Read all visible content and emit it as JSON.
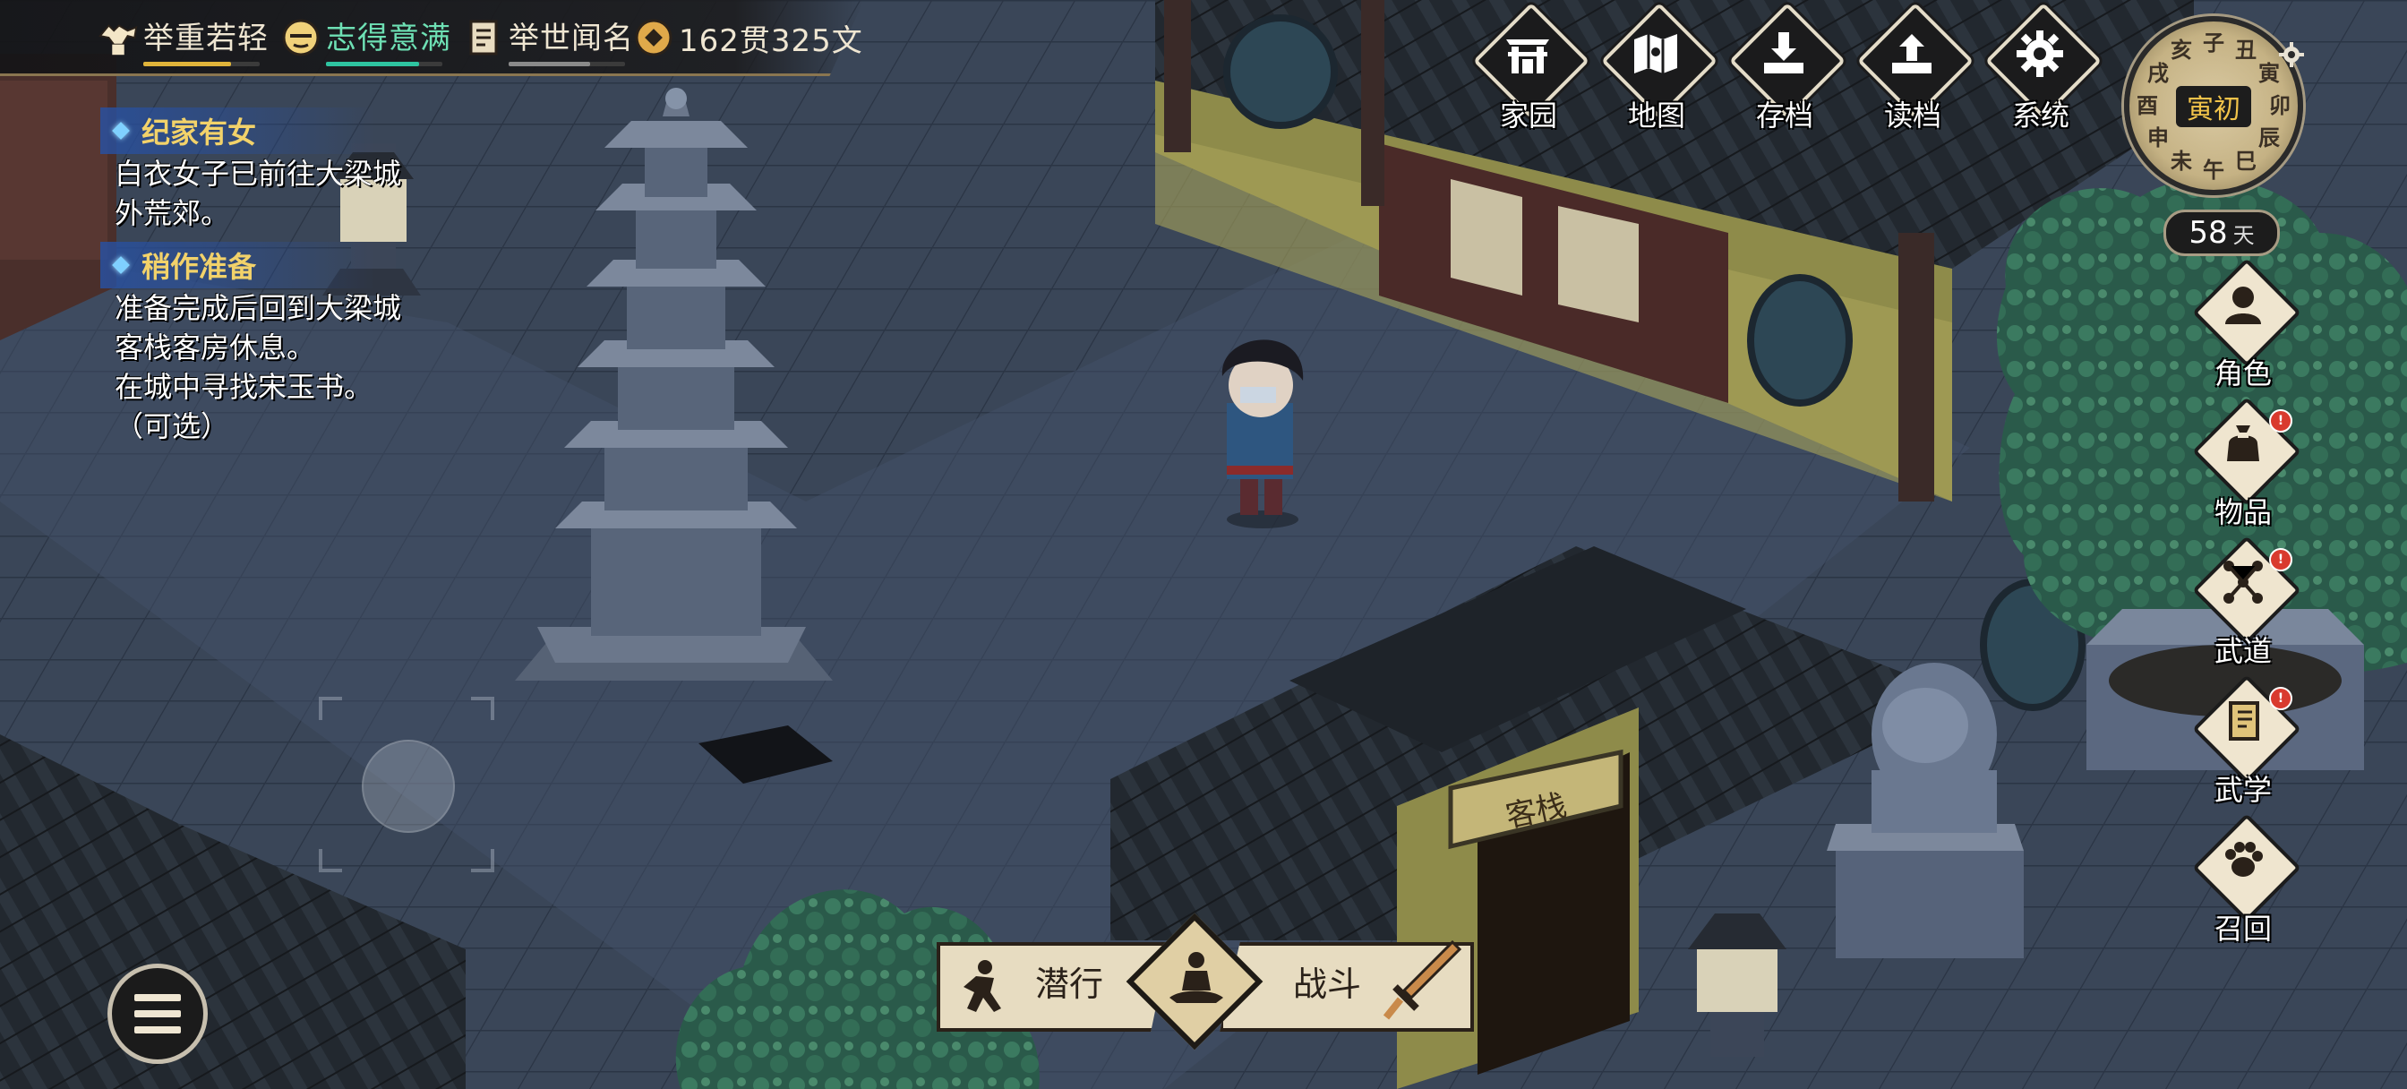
{
  "status_bar": {
    "stats": [
      {
        "icon": "muscle-icon",
        "label": "举重若轻",
        "bar_color": "#e0b43a",
        "fill": 0.75
      },
      {
        "icon": "face-icon",
        "label": "志得意满",
        "bar_color": "#2ec4a0",
        "fill": 0.8,
        "label_color": "#6ee0b4"
      },
      {
        "icon": "scroll-icon",
        "label": "举世闻名",
        "bar_color": "#8a8a8a",
        "fill": 0.7
      }
    ],
    "money": {
      "icon": "coin-icon",
      "label": "162贯325文"
    }
  },
  "quests": [
    {
      "title": "纪家有女",
      "lines": [
        "白衣女子已前往大梁城",
        "外荒郊。"
      ]
    },
    {
      "title": "稍作准备",
      "lines": [
        "准备完成后回到大梁城",
        "客栈客房休息。",
        "在城中寻找宋玉书。",
        "（可选）"
      ]
    }
  ],
  "top_menu": [
    {
      "label": "家园",
      "icon": "home-gate-icon"
    },
    {
      "label": "地图",
      "icon": "map-icon"
    },
    {
      "label": "存档",
      "icon": "save-icon"
    },
    {
      "label": "读档",
      "icon": "load-icon"
    },
    {
      "label": "系统",
      "icon": "gear-icon"
    }
  ],
  "clock": {
    "current": "寅初",
    "hours": [
      "子",
      "丑",
      "寅",
      "卯",
      "辰",
      "巳",
      "午",
      "未",
      "申",
      "酉",
      "戌",
      "亥"
    ]
  },
  "day": {
    "value": "58",
    "unit": "天"
  },
  "side_menu": [
    {
      "label": "角色",
      "icon": "character-icon",
      "badge": false
    },
    {
      "label": "物品",
      "icon": "bag-icon",
      "badge": true
    },
    {
      "label": "武道",
      "icon": "martial-path-icon",
      "badge": true
    },
    {
      "label": "武学",
      "icon": "manual-book-icon",
      "badge": true
    },
    {
      "label": "召回",
      "icon": "paw-icon",
      "badge": false
    }
  ],
  "action_bar": {
    "left_label": "潜行",
    "right_label": "战斗",
    "center_icon": "meditate-icon"
  },
  "scene": {
    "building_sign": "客栈"
  },
  "colors": {
    "quest_title": "#f2d26a",
    "quest_title_bg": "#2850a0",
    "ui_dark": "#1b1b1c",
    "ui_cream": "#efe5cf",
    "badge_red": "#d93a2e"
  }
}
